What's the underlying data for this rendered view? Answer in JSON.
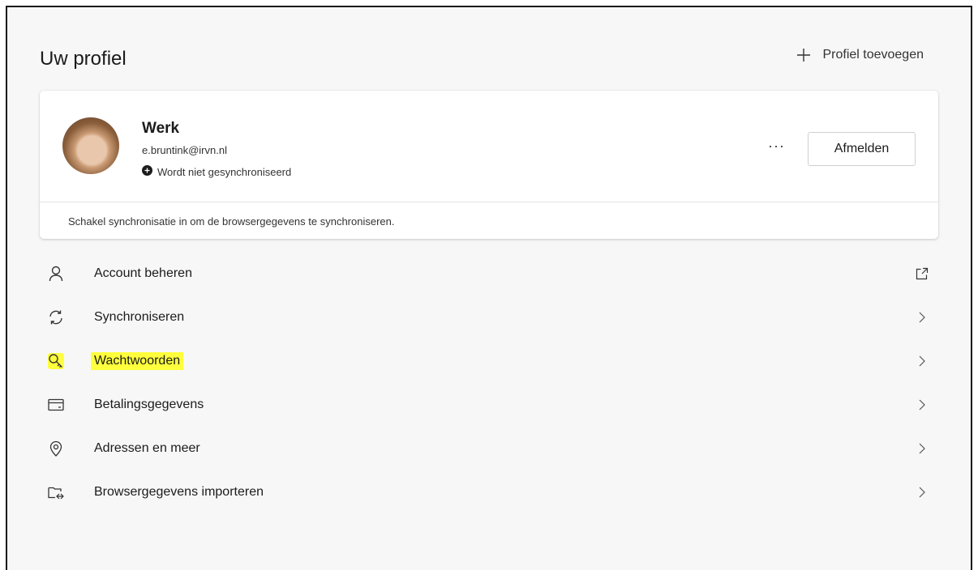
{
  "header": {
    "title": "Uw profiel",
    "add_profile_label": "Profiel toevoegen",
    "add_profile_icon": "plus-icon"
  },
  "profile": {
    "name": "Werk",
    "email": "e.bruntink@irvn.nl",
    "sync_status": "Wordt niet gesynchroniseerd",
    "sync_status_icon": "sync-off-icon",
    "more_label": "···",
    "signout_label": "Afmelden",
    "sync_hint": "Schakel synchronisatie in om de browsergegevens te synchroniseren."
  },
  "menu": {
    "items": [
      {
        "label": "Account beheren",
        "icon": "person-icon",
        "trail": "external-link-icon"
      },
      {
        "label": "Synchroniseren",
        "icon": "sync-icon",
        "trail": "chevron-right-icon"
      },
      {
        "label": "Wachtwoorden",
        "icon": "key-icon",
        "trail": "chevron-right-icon",
        "highlighted": true
      },
      {
        "label": "Betalingsgegevens",
        "icon": "card-icon",
        "trail": "chevron-right-icon"
      },
      {
        "label": "Adressen en meer",
        "icon": "location-pin-icon",
        "trail": "chevron-right-icon"
      },
      {
        "label": "Browsergegevens importeren",
        "icon": "import-icon",
        "trail": "chevron-right-icon"
      }
    ]
  },
  "colors": {
    "background": "#f7f7f7",
    "card": "#ffffff",
    "highlight": "#ffff3d",
    "text": "#1b1b1b"
  }
}
